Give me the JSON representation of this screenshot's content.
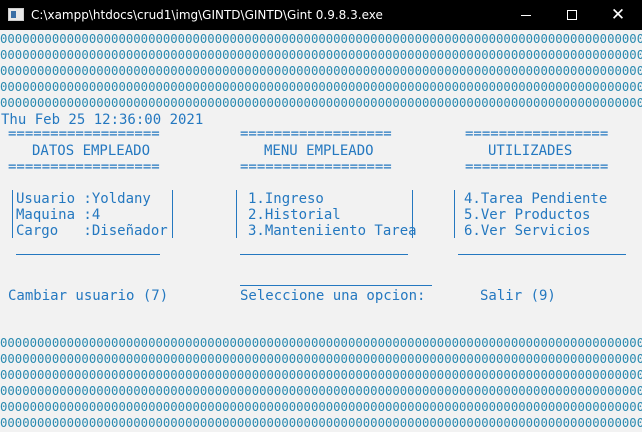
{
  "window": {
    "title": "C:\\xampp\\htdocs\\crud1\\img\\GINTD\\GINTD\\Gint 0.9.8.3.exe",
    "minimize_glyph": "",
    "maximize_glyph": "",
    "close_glyph": "✕"
  },
  "console": {
    "pattern_row": "0000000000000000000000000000000000000000000000000000000000000000000000000000000000000000000000000",
    "datetime": "Thu Feb 25 12:36:00 2021",
    "sections": {
      "datos": {
        "rule": "==================",
        "title": "DATOS EMPLEADO"
      },
      "menu": {
        "rule": "==================",
        "title": "MENU EMPLEADO"
      },
      "utilidades": {
        "rule": "=================",
        "title": "UTILIZADES"
      }
    },
    "datos_lines": [
      "Usuario :Yoldany",
      "Maquina :4",
      "Cargo   :Diseñador"
    ],
    "menu_lines": [
      "1.Ingreso",
      "2.Historial",
      "3.Manteniiento Tarea"
    ],
    "util_lines": [
      "4.Tarea Pendiente",
      "5.Ver Productos",
      "6.Ver Servicios"
    ],
    "cambiar_usuario": "Cambiar usuario (7)",
    "seleccione": "Seleccione una opcion:",
    "salir": "Salir (9)"
  }
}
